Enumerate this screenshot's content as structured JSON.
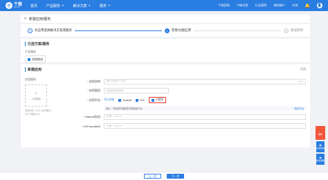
{
  "topbar": {
    "logo": "个推",
    "logo_sub": "GETUI",
    "nav": [
      "首页",
      "产品服务",
      "解决方案",
      "服务"
    ],
    "right_nav": [
      "个推官网",
      "个推学堂",
      "行业案例",
      "我的账户",
      "文档"
    ]
  },
  "header": {
    "back": "<",
    "title": "新建应用/服务"
  },
  "steps": [
    {
      "num": "1",
      "label": "为应用选择解决方案或服务"
    },
    {
      "num": "2",
      "label": "完善/创建应用"
    },
    {
      "num": "3",
      "label": "集成使用"
    }
  ],
  "selected": {
    "title": "已选方案/服务",
    "sub": "产品服务",
    "chip": "消息推送"
  },
  "new_app": {
    "title": "新建应用",
    "option": "选填",
    "icon_label": "应用图标:",
    "upload_text": "上传图标",
    "upload_hint": "支持PNG, JPG, BMP格式，大小不超过1M",
    "fields": {
      "name_label": "应用名称:",
      "name_placeholder": "最大长度32个字符",
      "name_count": "0/32",
      "type_label": "应用类型:",
      "type_placeholder": "请选择应用类型",
      "platform_label": "应用平台:",
      "platform_hint": "可以多选",
      "android": "Android",
      "ios": "iOS",
      "mini": "小程序",
      "notice": "提示：可选择开通或暂不使用该平台",
      "notice_link": "+ 推送平台",
      "android_label": "Android包名:",
      "android_placeholder": "示例：com.xx",
      "ios_label": "iOS bundleID:",
      "ios_placeholder": "示例：com.xx"
    }
  },
  "footer": {
    "prev": "上一步",
    "next": "下一步"
  },
  "widgets": {
    "gift": "福利",
    "w1": "在线咨询",
    "w2": "联系客服"
  }
}
